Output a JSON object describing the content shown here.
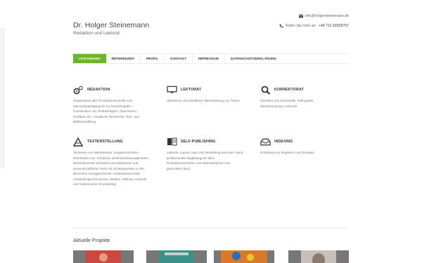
{
  "header": {
    "title": "Dr. Holger Steinemann",
    "subtitle": "Redaktion und Lektorat"
  },
  "contact": {
    "email": "info@holgersteinemann.de",
    "phone_prefix": "Rufen Sie mich an:",
    "phone_number": "+49 711 92539707",
    "email_icon": "envelope-icon",
    "phone_icon": "phone-icon"
  },
  "nav": {
    "items": [
      "LEISTUNGEN",
      "REFERENZEN",
      "PROFIL",
      "KONTAKT",
      "IMPRESSUM",
      "DATENSCHUTZERKLÄRUNG"
    ],
    "active_index": 0,
    "active_color": "#6cb52d"
  },
  "services": [
    {
      "icon": "gears-icon",
      "title": "REDAKTION",
      "text": "Organisation aller Produktionsschritte vom Manuskripteingang bis zur Druckfreigabe – Koordination von Textbeiträgern, Übersetzern, Grafikern etc.; inhaltliche Recherche; Text- und Bildbeschaffung"
    },
    {
      "icon": "monitor-icon",
      "title": "LEKTORAT",
      "text": "Stilistische und inhaltliche Überarbeitung von Texten"
    },
    {
      "icon": "magnifier-icon",
      "title": "KORREKTORAT",
      "text": "Korrektur von Grammatik, Orthografie, Zeichensetzung, Umbruch"
    },
    {
      "icon": "quill-icon",
      "title": "TEXTERSTELLUNG",
      "text": "Verfassen von Werbetexten, Imagebroschüren, Newslettern etc. Verfassen suchmaschinenoptimierter Webseitentexte Verfassen journalistischer und wissenschaftlicher Texte mit Schwerpunkten in den Bereichen Kunstgeschichte, Kulturwissenschaft, Ausstellungsrezensionen, Medien, Bildung, Kulinarik und Gastronomie Ghostwriting"
    },
    {
      "icon": "book-icon",
      "title": "SELF-PUBLISHING",
      "text": "Lektorat, Layout, Satz und Herstellung aus einer Hand: professionelle Begleitung bei allen Produktionsschritten vom Manuskript bis zum gedruckten Buch"
    },
    {
      "icon": "inbox-icon",
      "title": "INDEXING",
      "text": "Erstellung von Registern und Glossars"
    }
  ],
  "projects": {
    "title": "Aktuelle Projekte",
    "colors": [
      "#c9483f",
      "#3a8f86",
      "#d97a2a",
      "#8a7a70"
    ]
  }
}
